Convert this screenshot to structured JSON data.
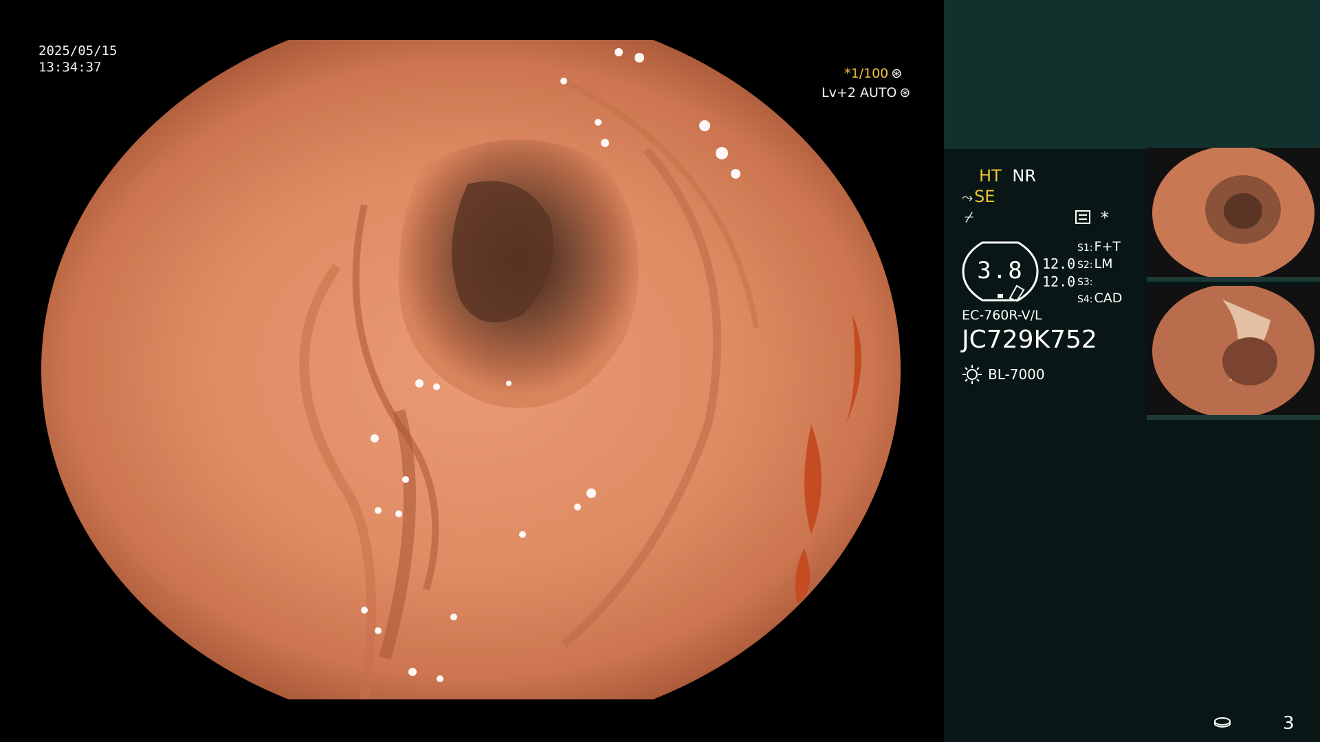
{
  "datetime": {
    "date": "2025/05/15",
    "time": "13:34:37"
  },
  "overlay": {
    "shutter": "*1/100",
    "level": "Lv+2 AUTO"
  },
  "status": {
    "ht": "HT",
    "nr": "NR",
    "se": "SE",
    "star": "*",
    "gauge_value": "3.8",
    "num_1": "12.0",
    "num_2": "12.0",
    "switches": [
      {
        "key": "S1:",
        "value": "F+T"
      },
      {
        "key": "S2:",
        "value": "LM"
      },
      {
        "key": "S3:",
        "value": ""
      },
      {
        "key": "S4:",
        "value": "CAD"
      }
    ],
    "scope_model": "EC-760R-V/L",
    "serial": "JC729K752",
    "light_source": "BL-7000"
  },
  "footer": {
    "page": "3"
  },
  "icons": [
    "gear-icon",
    "settings-icon",
    "wave-icon",
    "sun-icon",
    "memory-icon"
  ],
  "colors": {
    "panel_bg": "#081715",
    "panel_top": "#12302c",
    "mode_yellow": "#f4c23a",
    "tissue": "#d8825a"
  }
}
